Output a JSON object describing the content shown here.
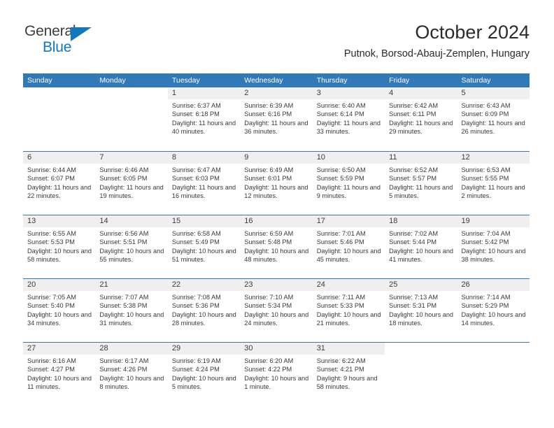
{
  "brand": {
    "name_part1": "General",
    "name_part2": "Blue",
    "accent_color": "#1277bc",
    "triangle_icon": "brand-triangle-icon"
  },
  "header": {
    "title": "October 2024",
    "subtitle": "Putnok, Borsod-Abauj-Zemplen, Hungary"
  },
  "calendar": {
    "header_bg": "#3179b7",
    "header_text_color": "#ffffff",
    "daynum_band_bg": "#efefef",
    "weekdays": [
      "Sunday",
      "Monday",
      "Tuesday",
      "Wednesday",
      "Thursday",
      "Friday",
      "Saturday"
    ],
    "weeks": [
      [
        {
          "day": "",
          "sunrise": "",
          "sunset": "",
          "daylight": "",
          "empty": true
        },
        {
          "day": "",
          "sunrise": "",
          "sunset": "",
          "daylight": "",
          "empty": true
        },
        {
          "day": "1",
          "sunrise": "Sunrise: 6:37 AM",
          "sunset": "Sunset: 6:18 PM",
          "daylight": "Daylight: 11 hours and 40 minutes."
        },
        {
          "day": "2",
          "sunrise": "Sunrise: 6:39 AM",
          "sunset": "Sunset: 6:16 PM",
          "daylight": "Daylight: 11 hours and 36 minutes."
        },
        {
          "day": "3",
          "sunrise": "Sunrise: 6:40 AM",
          "sunset": "Sunset: 6:14 PM",
          "daylight": "Daylight: 11 hours and 33 minutes."
        },
        {
          "day": "4",
          "sunrise": "Sunrise: 6:42 AM",
          "sunset": "Sunset: 6:11 PM",
          "daylight": "Daylight: 11 hours and 29 minutes."
        },
        {
          "day": "5",
          "sunrise": "Sunrise: 6:43 AM",
          "sunset": "Sunset: 6:09 PM",
          "daylight": "Daylight: 11 hours and 26 minutes."
        }
      ],
      [
        {
          "day": "6",
          "sunrise": "Sunrise: 6:44 AM",
          "sunset": "Sunset: 6:07 PM",
          "daylight": "Daylight: 11 hours and 22 minutes."
        },
        {
          "day": "7",
          "sunrise": "Sunrise: 6:46 AM",
          "sunset": "Sunset: 6:05 PM",
          "daylight": "Daylight: 11 hours and 19 minutes."
        },
        {
          "day": "8",
          "sunrise": "Sunrise: 6:47 AM",
          "sunset": "Sunset: 6:03 PM",
          "daylight": "Daylight: 11 hours and 16 minutes."
        },
        {
          "day": "9",
          "sunrise": "Sunrise: 6:49 AM",
          "sunset": "Sunset: 6:01 PM",
          "daylight": "Daylight: 11 hours and 12 minutes."
        },
        {
          "day": "10",
          "sunrise": "Sunrise: 6:50 AM",
          "sunset": "Sunset: 5:59 PM",
          "daylight": "Daylight: 11 hours and 9 minutes."
        },
        {
          "day": "11",
          "sunrise": "Sunrise: 6:52 AM",
          "sunset": "Sunset: 5:57 PM",
          "daylight": "Daylight: 11 hours and 5 minutes."
        },
        {
          "day": "12",
          "sunrise": "Sunrise: 6:53 AM",
          "sunset": "Sunset: 5:55 PM",
          "daylight": "Daylight: 11 hours and 2 minutes."
        }
      ],
      [
        {
          "day": "13",
          "sunrise": "Sunrise: 6:55 AM",
          "sunset": "Sunset: 5:53 PM",
          "daylight": "Daylight: 10 hours and 58 minutes."
        },
        {
          "day": "14",
          "sunrise": "Sunrise: 6:56 AM",
          "sunset": "Sunset: 5:51 PM",
          "daylight": "Daylight: 10 hours and 55 minutes."
        },
        {
          "day": "15",
          "sunrise": "Sunrise: 6:58 AM",
          "sunset": "Sunset: 5:49 PM",
          "daylight": "Daylight: 10 hours and 51 minutes."
        },
        {
          "day": "16",
          "sunrise": "Sunrise: 6:59 AM",
          "sunset": "Sunset: 5:48 PM",
          "daylight": "Daylight: 10 hours and 48 minutes."
        },
        {
          "day": "17",
          "sunrise": "Sunrise: 7:01 AM",
          "sunset": "Sunset: 5:46 PM",
          "daylight": "Daylight: 10 hours and 45 minutes."
        },
        {
          "day": "18",
          "sunrise": "Sunrise: 7:02 AM",
          "sunset": "Sunset: 5:44 PM",
          "daylight": "Daylight: 10 hours and 41 minutes."
        },
        {
          "day": "19",
          "sunrise": "Sunrise: 7:04 AM",
          "sunset": "Sunset: 5:42 PM",
          "daylight": "Daylight: 10 hours and 38 minutes."
        }
      ],
      [
        {
          "day": "20",
          "sunrise": "Sunrise: 7:05 AM",
          "sunset": "Sunset: 5:40 PM",
          "daylight": "Daylight: 10 hours and 34 minutes."
        },
        {
          "day": "21",
          "sunrise": "Sunrise: 7:07 AM",
          "sunset": "Sunset: 5:38 PM",
          "daylight": "Daylight: 10 hours and 31 minutes."
        },
        {
          "day": "22",
          "sunrise": "Sunrise: 7:08 AM",
          "sunset": "Sunset: 5:36 PM",
          "daylight": "Daylight: 10 hours and 28 minutes."
        },
        {
          "day": "23",
          "sunrise": "Sunrise: 7:10 AM",
          "sunset": "Sunset: 5:34 PM",
          "daylight": "Daylight: 10 hours and 24 minutes."
        },
        {
          "day": "24",
          "sunrise": "Sunrise: 7:11 AM",
          "sunset": "Sunset: 5:33 PM",
          "daylight": "Daylight: 10 hours and 21 minutes."
        },
        {
          "day": "25",
          "sunrise": "Sunrise: 7:13 AM",
          "sunset": "Sunset: 5:31 PM",
          "daylight": "Daylight: 10 hours and 18 minutes."
        },
        {
          "day": "26",
          "sunrise": "Sunrise: 7:14 AM",
          "sunset": "Sunset: 5:29 PM",
          "daylight": "Daylight: 10 hours and 14 minutes."
        }
      ],
      [
        {
          "day": "27",
          "sunrise": "Sunrise: 6:16 AM",
          "sunset": "Sunset: 4:27 PM",
          "daylight": "Daylight: 10 hours and 11 minutes."
        },
        {
          "day": "28",
          "sunrise": "Sunrise: 6:17 AM",
          "sunset": "Sunset: 4:26 PM",
          "daylight": "Daylight: 10 hours and 8 minutes."
        },
        {
          "day": "29",
          "sunrise": "Sunrise: 6:19 AM",
          "sunset": "Sunset: 4:24 PM",
          "daylight": "Daylight: 10 hours and 5 minutes."
        },
        {
          "day": "30",
          "sunrise": "Sunrise: 6:20 AM",
          "sunset": "Sunset: 4:22 PM",
          "daylight": "Daylight: 10 hours and 1 minute."
        },
        {
          "day": "31",
          "sunrise": "Sunrise: 6:22 AM",
          "sunset": "Sunset: 4:21 PM",
          "daylight": "Daylight: 9 hours and 58 minutes."
        },
        {
          "day": "",
          "sunrise": "",
          "sunset": "",
          "daylight": "",
          "empty": true
        },
        {
          "day": "",
          "sunrise": "",
          "sunset": "",
          "daylight": "",
          "empty": true
        }
      ]
    ]
  }
}
